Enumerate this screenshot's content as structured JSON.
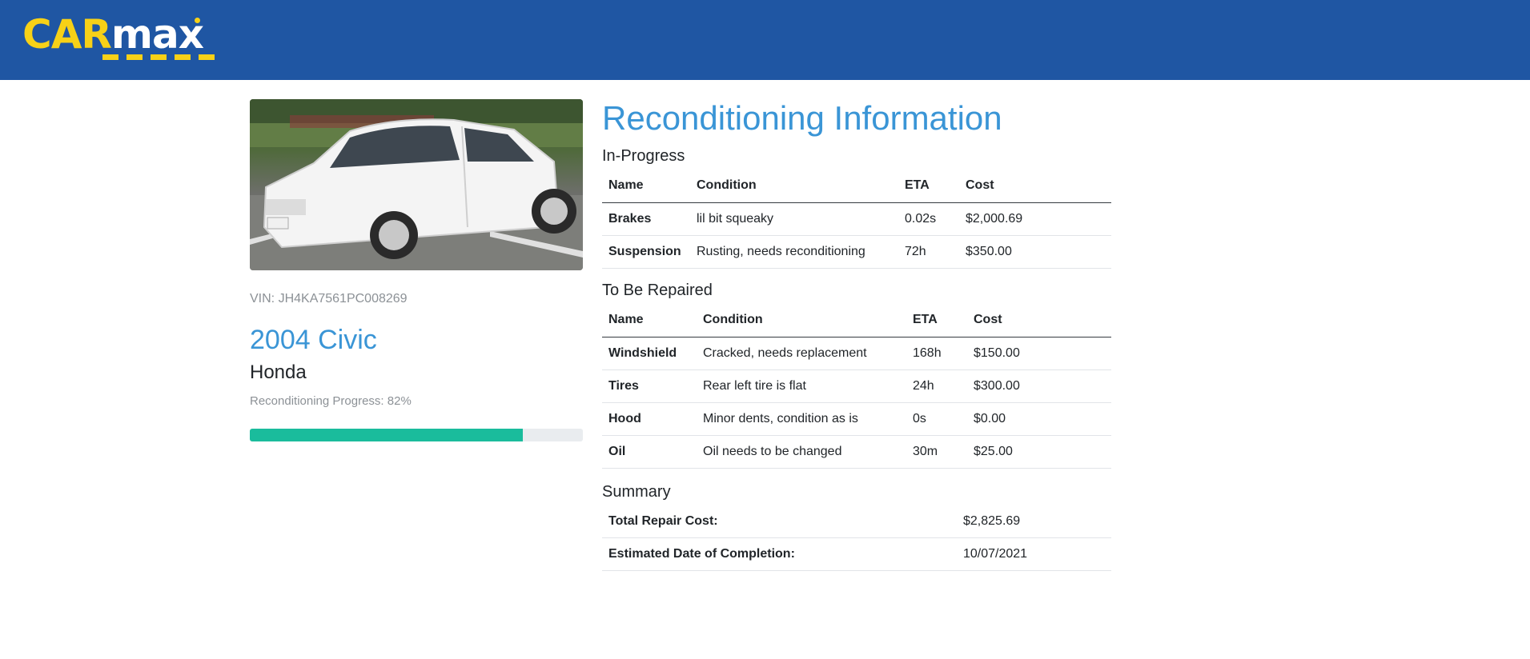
{
  "header": {
    "logo": {
      "part1": "CAR",
      "part2": "max"
    }
  },
  "vehicle": {
    "image_alt": "white sedan",
    "vin": "VIN: JH4KA7561PC008269",
    "model": "2004 Civic",
    "make": "Honda",
    "progress_label": "Reconditioning Progress: 82%",
    "progress_value": 82
  },
  "page_title": "Reconditioning Information",
  "in_progress": {
    "title": "In-Progress",
    "columns": [
      "Name",
      "Condition",
      "ETA",
      "Cost"
    ],
    "rows": [
      [
        "Brakes",
        "lil bit squeaky",
        "0.02s",
        "$2,000.69"
      ],
      [
        "Suspension",
        "Rusting, needs reconditioning",
        "72h",
        "$350.00"
      ]
    ]
  },
  "to_be_repaired": {
    "title": "To Be Repaired",
    "columns": [
      "Name",
      "Condition",
      "ETA",
      "Cost"
    ],
    "rows": [
      [
        "Windshield",
        "Cracked, needs replacement",
        "168h",
        "$150.00"
      ],
      [
        "Tires",
        "Rear left tire is flat",
        "24h",
        "$300.00"
      ],
      [
        "Hood",
        "Minor dents, condition as is",
        "0s",
        "$0.00"
      ],
      [
        "Oil",
        "Oil needs to be changed",
        "30m",
        "$25.00"
      ]
    ]
  },
  "summary": {
    "title": "Summary",
    "rows": [
      [
        "Total Repair Cost:",
        "$2,825.69"
      ],
      [
        "Estimated Date of Completion:",
        "10/07/2021"
      ]
    ]
  },
  "colors": {
    "header_bg": "#1f56a3",
    "logo_yellow": "#f7d117",
    "accent_blue": "#3a95d6",
    "progress_fill": "#1abc9c"
  }
}
